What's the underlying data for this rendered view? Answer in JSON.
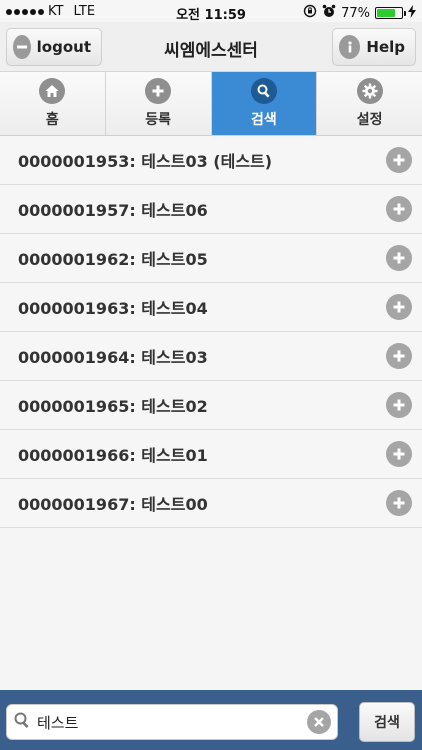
{
  "status_bar": {
    "carrier": "KT",
    "network": "LTE",
    "time": "오전 11:59",
    "battery": "77%",
    "battery_level": 0.77,
    "battery_color": "#2ecc2e"
  },
  "header": {
    "title": "씨엠에스센터",
    "logout_label": "logout",
    "help_label": "Help",
    "logout_icon": "minus-circle-icon",
    "help_icon": "info-circle-icon"
  },
  "tabs": [
    {
      "label": "홈",
      "icon": "home-icon",
      "active": false
    },
    {
      "label": "등록",
      "icon": "plus-circle-icon",
      "active": false
    },
    {
      "label": "검색",
      "icon": "search-icon",
      "active": true
    },
    {
      "label": "설정",
      "icon": "gear-icon",
      "active": false
    }
  ],
  "colors": {
    "accent": "#3a8ad4",
    "footer": "#3b5f8c"
  },
  "results": [
    {
      "label": "0000001953: 테스트03 (테스트)"
    },
    {
      "label": "0000001957: 테스트06"
    },
    {
      "label": "0000001962: 테스트05"
    },
    {
      "label": "0000001963: 테스트04"
    },
    {
      "label": "0000001964: 테스트03"
    },
    {
      "label": "0000001965: 테스트02"
    },
    {
      "label": "0000001966: 테스트01"
    },
    {
      "label": "0000001967: 테스트00"
    }
  ],
  "footer": {
    "search_value": "테스트",
    "search_button": "검색"
  }
}
